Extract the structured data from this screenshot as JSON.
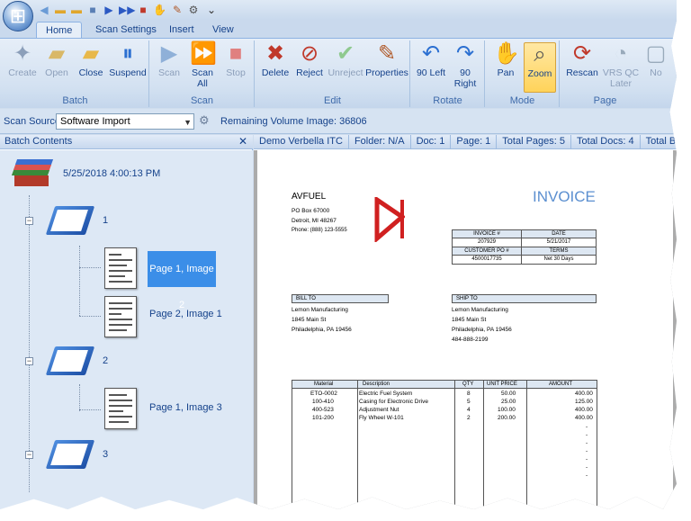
{
  "ribbon_tabs": [
    "Home",
    "Scan Settings",
    "Insert",
    "View"
  ],
  "groups": {
    "batch": {
      "label": "Batch",
      "buttons": [
        "Create",
        "Open",
        "Close",
        "Suspend"
      ]
    },
    "scan": {
      "label": "Scan",
      "buttons": [
        "Scan",
        "Scan All",
        "Stop"
      ]
    },
    "edit": {
      "label": "Edit",
      "buttons": [
        "Delete",
        "Reject",
        "Unreject",
        "Properties"
      ]
    },
    "rotate": {
      "label": "Rotate",
      "buttons": [
        "90 Left",
        "90 Right"
      ]
    },
    "mode": {
      "label": "Mode",
      "buttons": [
        "Pan",
        "Zoom"
      ]
    },
    "page": {
      "label": "Page",
      "buttons": [
        "Rescan",
        "VRS QC Later",
        "No"
      ]
    }
  },
  "scan_source": {
    "label": "Scan Source:",
    "value": "Software Import",
    "remaining": "Remaining Volume Image: 36806"
  },
  "batch_panel": {
    "title": "Batch Contents",
    "root": "5/25/2018 4:00:13 PM",
    "docs": [
      "1",
      "2",
      "3"
    ],
    "pages": [
      "Page 1, Image 2",
      "Page 2, Image 1",
      "Page 1, Image 3"
    ]
  },
  "status": [
    "Demo Verbella ITC",
    "Folder: N/A",
    "Doc: 1",
    "Page: 1",
    "Total Pages: 5",
    "Total Docs: 4",
    "Total B"
  ],
  "invoice": {
    "company": "AVFUEL",
    "address": [
      "PO Box 67000",
      "Detroit, MI 48267",
      "Phone: (888) 123-5555"
    ],
    "title": "INVOICE",
    "meta_headers": [
      "INVOICE #",
      "DATE",
      "CUSTOMER PO #",
      "TERMS"
    ],
    "meta_values": [
      "207929",
      "5/21/2017",
      "4500017735",
      "Net 30 Days"
    ],
    "bill_to_label": "BILL TO",
    "bill_to": [
      "Lemon Manufacturing",
      "1845 Main St",
      "Philadelphia, PA 19456"
    ],
    "ship_to_label": "SHIP TO",
    "ship_to": [
      "Lemon Manufacturing",
      "1845 Main St",
      "Philadelphia, PA 19456",
      "484-888-2199"
    ],
    "table_headers": [
      "Material",
      "Description",
      "QTY",
      "UNIT PRICE",
      "AMOUNT"
    ],
    "rows": [
      [
        "ETO-0002",
        "Electric Fuel System",
        "8",
        "50.00",
        "400.00"
      ],
      [
        "100-410",
        "Casing for Electronic Drive",
        "5",
        "25.00",
        "125.00"
      ],
      [
        "400-523",
        "Adjustment Nut",
        "4",
        "100.00",
        "400.00"
      ],
      [
        "101-200",
        "Fly Wheel W-101",
        "2",
        "200.00",
        "400.00"
      ]
    ],
    "dash": "-"
  },
  "colors": {
    "accent": "#3b8ee8",
    "ribbon_bg": "#d3e1f1",
    "selected_button": "#ffd35a"
  }
}
